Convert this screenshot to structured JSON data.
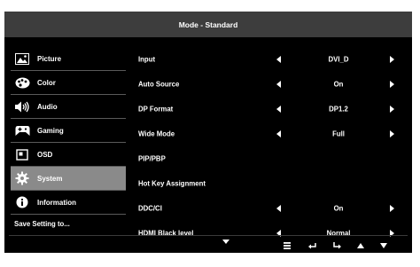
{
  "title": "Mode - Standard",
  "sidebar": {
    "items": [
      {
        "label": "Picture",
        "icon": "picture-icon",
        "selected": false
      },
      {
        "label": "Color",
        "icon": "palette-icon",
        "selected": false
      },
      {
        "label": "Audio",
        "icon": "speaker-icon",
        "selected": false
      },
      {
        "label": "Gaming",
        "icon": "gamepad-icon",
        "selected": false
      },
      {
        "label": "OSD",
        "icon": "osd-icon",
        "selected": false
      },
      {
        "label": "System",
        "icon": "gear-icon",
        "selected": true
      },
      {
        "label": "Information",
        "icon": "info-icon",
        "selected": false
      }
    ],
    "save_label": "Save Setting to..."
  },
  "settings": [
    {
      "label": "Input",
      "value": "DVI_D"
    },
    {
      "label": "Auto Source",
      "value": "On"
    },
    {
      "label": "DP Format",
      "value": "DP1.2"
    },
    {
      "label": "Wide Mode",
      "value": "Full"
    },
    {
      "label": "PIP/PBP",
      "value": ""
    },
    {
      "label": "Hot Key Assignment",
      "value": ""
    },
    {
      "label": "DDC/CI",
      "value": "On"
    },
    {
      "label": "HDMI Black level",
      "value": "Normal"
    }
  ],
  "bottom_nav": [
    "menu-icon",
    "return-icon",
    "enter-icon",
    "up-icon",
    "down-icon"
  ],
  "colors": {
    "panel": "#000000",
    "titlebar": "#3d3d3d",
    "selected": "#8a8a8a",
    "text": "#ffffff"
  }
}
